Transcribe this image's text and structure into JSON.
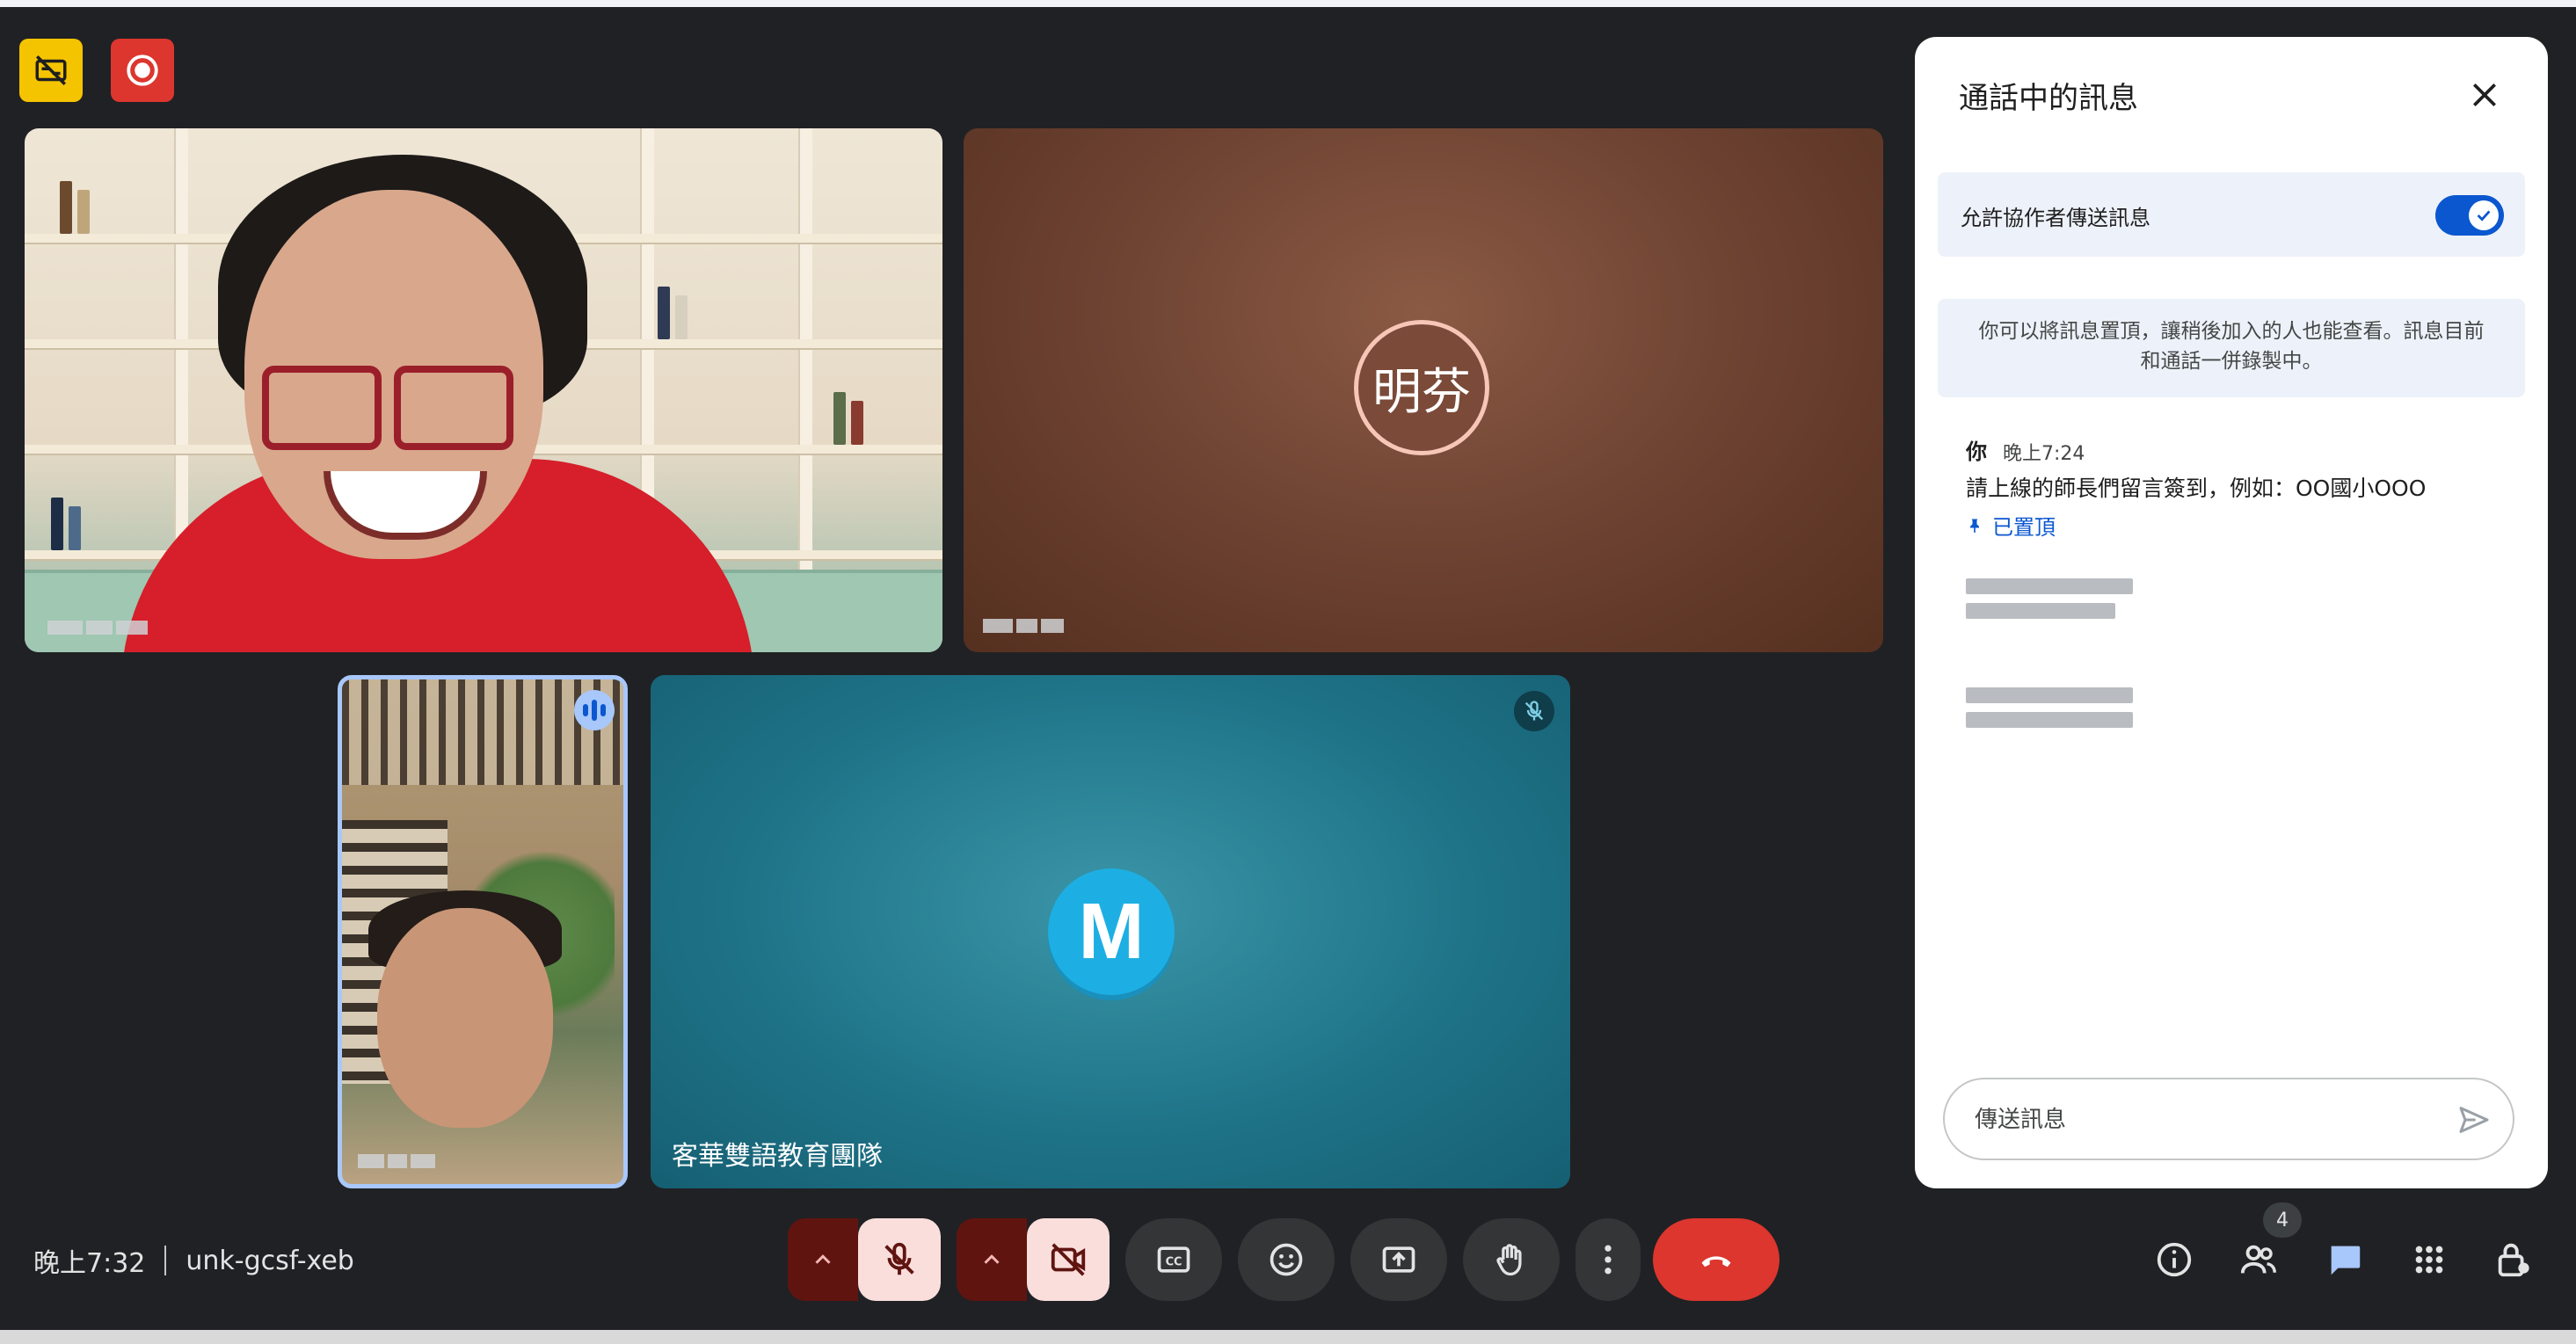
{
  "top_controls": {
    "captions_off_icon": "no-captions-icon",
    "record_icon": "record-icon",
    "captions_bg": "#f5c400",
    "record_bg": "#dc362e"
  },
  "tiles": [
    {
      "type": "video",
      "name": ""
    },
    {
      "type": "avatar",
      "initials": "明芬",
      "name": ""
    },
    {
      "type": "video",
      "name": "",
      "speaking": true
    },
    {
      "type": "avatar",
      "initials": "M",
      "name": "客華雙語教育團隊",
      "muted": true
    }
  ],
  "chat": {
    "title": "通話中的訊息",
    "allow_label": "允許協作者傳送訊息",
    "allow_enabled": true,
    "info_line1": "你可以將訊息置頂，讓稍後加入的人也能查看。訊息目前",
    "info_line2": "和通話一併錄製中。",
    "message": {
      "author": "你",
      "time": "晚上7:24",
      "text": "請上線的師長們留言簽到，例如：OO國小OOO",
      "pinned_label": "已置頂"
    },
    "compose_placeholder": "傳送訊息"
  },
  "meeting": {
    "time": "晚上7:32",
    "code": "unk-gcsf-xeb"
  },
  "people_count": "4",
  "colors": {
    "accent_blue": "#0b57d0",
    "end_call_red": "#dc362e",
    "muted_bg": "#f9dedc",
    "muted_caret_bg": "#601410"
  }
}
